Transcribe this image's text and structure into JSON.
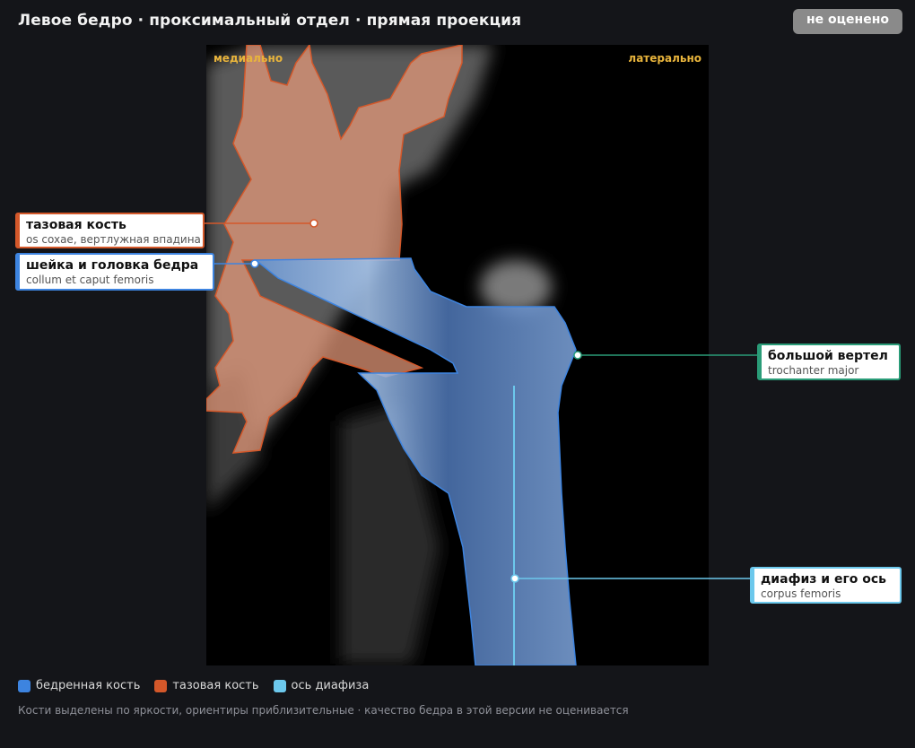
{
  "header": {
    "title": "Левое бедро · проксимальный отдел · прямая проекция",
    "status_button": "не оценено"
  },
  "viewer": {
    "orientation_left": "медиально",
    "orientation_right": "латерально"
  },
  "annotations": [
    {
      "main": "тазовая кость",
      "sub": "os coxae, вертлужная впадина",
      "color": "#d4582a"
    },
    {
      "main": "шейка и головка бедра",
      "sub": "collum et caput femoris",
      "color": "#3d84e0"
    },
    {
      "main": "большой вертел",
      "sub": "trochanter major",
      "color": "#2a9c78"
    },
    {
      "main": "диафиз и его ось",
      "sub": "corpus femoris",
      "color": "#6cc8ec"
    }
  ],
  "legend": [
    {
      "label": "бедренная кость",
      "color": "#3d84e0"
    },
    {
      "label": "тазовая кость",
      "color": "#d4582a"
    },
    {
      "label": "ось диафиза",
      "color": "#6cc8ec"
    }
  ],
  "footnote": "Кости выделены по яркости, ориентиры приблизительные · качество бедра в этой версии не оценивается"
}
